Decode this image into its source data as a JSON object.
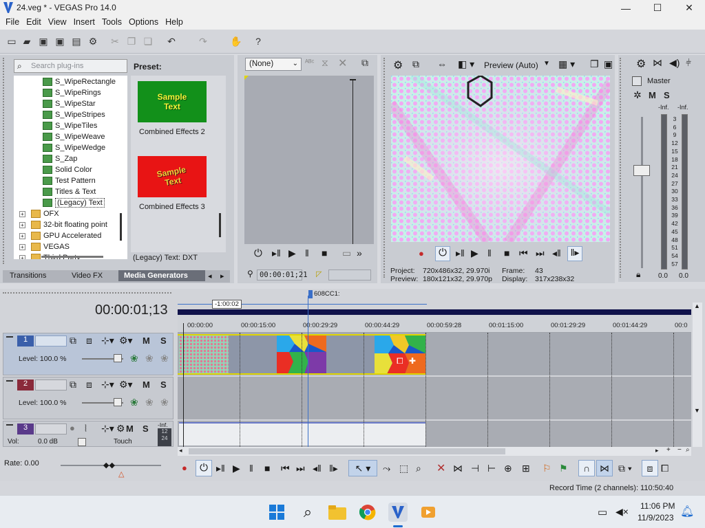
{
  "window": {
    "title": "24.veg * - VEGAS Pro 14.0",
    "minimize": "—",
    "maximize": "☐",
    "close": "✕"
  },
  "menu": [
    "File",
    "Edit",
    "View",
    "Insert",
    "Tools",
    "Options",
    "Help"
  ],
  "plugins": {
    "search_placeholder": "Search plug-ins",
    "items": [
      "S_WipeRectangle",
      "S_WipeRings",
      "S_WipeStar",
      "S_WipeStripes",
      "S_WipeTiles",
      "S_WipeWeave",
      "S_WipeWedge",
      "S_Zap",
      "Solid Color",
      "Test Pattern",
      "Titles & Text",
      "(Legacy) Text"
    ],
    "folders": [
      "OFX",
      "32-bit floating point",
      "GPU Accelerated",
      "VEGAS",
      "Third Party"
    ],
    "preset_label": "Preset:",
    "presets": [
      {
        "thumb_text": "Sample Text",
        "caption": "Combined Effects 2",
        "bg": "#12901a",
        "fg": "#f7f23a"
      },
      {
        "thumb_text": "Sample Text",
        "caption": "Combined Effects 3",
        "bg": "#e81414",
        "fg": "#f0d23a"
      }
    ],
    "status": "(Legacy) Text: DXT",
    "tabs": [
      "Transitions",
      "Video FX",
      "Media Generators"
    ]
  },
  "trimmer": {
    "dropdown": "(None)",
    "timecode": "00:00:01;21"
  },
  "preview": {
    "mode": "Preview (Auto)",
    "project_label": "Project:",
    "project_value": "720x486x32, 29.970i",
    "frame_label": "Frame:",
    "frame_value": "43",
    "preview_label": "Preview:",
    "preview_value": "180x121x32, 29.970p",
    "display_label": "Display:",
    "display_value": "317x238x32"
  },
  "mixer": {
    "title": "Master",
    "m": "M",
    "s": "S",
    "inf_left": "-Inf.",
    "inf_right": "-Inf.",
    "scale": [
      "3",
      "6",
      "9",
      "12",
      "15",
      "18",
      "21",
      "24",
      "27",
      "30",
      "33",
      "36",
      "39",
      "42",
      "45",
      "48",
      "51",
      "54",
      "57"
    ],
    "level_left": "0.0",
    "level_right": "0.0"
  },
  "timeline": {
    "timecode": "00:00:01;13",
    "loop_region": "-1:00:02",
    "marker": "608CC1:",
    "ruler": [
      "00:00:00",
      "00:00:15:00",
      "00:00:29:29",
      "00:00:44:29",
      "00:00:59:28",
      "00:01:15:00",
      "00:01:29:29",
      "00:01:44:29",
      "00:0"
    ],
    "tracks": [
      {
        "num": "1",
        "level": "Level: 100.0 %",
        "m": "M",
        "s": "S"
      },
      {
        "num": "2",
        "level": "Level: 100.0 %",
        "m": "M",
        "s": "S"
      },
      {
        "num": "3",
        "vol": "Vol:",
        "vol_value": "0.0 dB",
        "touch": "Touch",
        "m": "M",
        "s": "S",
        "inf": "-Inf.",
        "db1": "12",
        "db2": "24"
      }
    ],
    "rate": "Rate: 0.00"
  },
  "status_record": "Record Time (2 channels): 110:50:40",
  "taskbar": {
    "time": "11:06 PM",
    "date": "11/9/2023"
  }
}
